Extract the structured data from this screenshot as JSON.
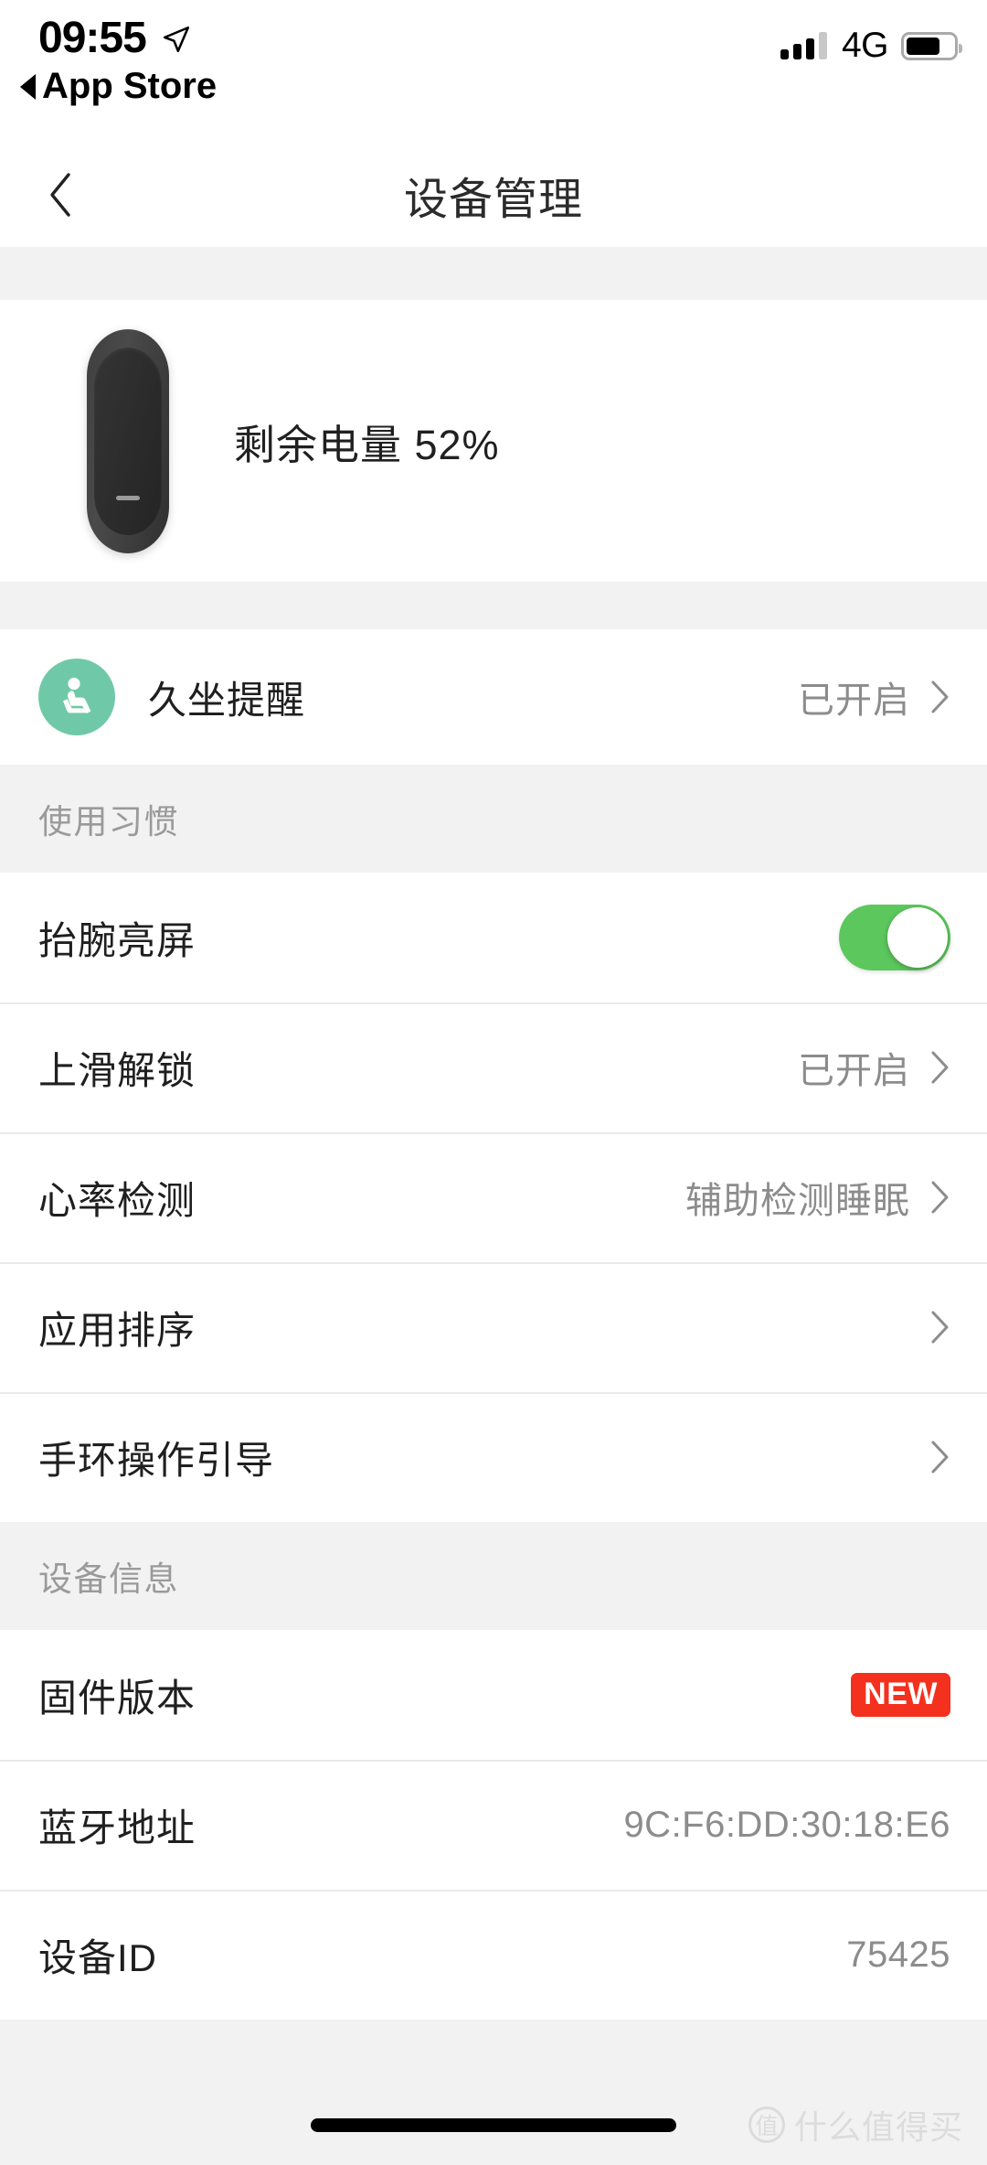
{
  "status_bar": {
    "time": "09:55",
    "location_icon": "location-arrow-icon",
    "back_app_label": "App Store",
    "network": "4G",
    "signal_bars_total": 4,
    "signal_bars_filled": 3,
    "battery_level_pct": 72
  },
  "nav": {
    "back_icon": "chevron-left-icon",
    "title": "设备管理"
  },
  "device": {
    "image_name": "mi-band-device",
    "battery_text": "剩余电量 52%"
  },
  "sedentary": {
    "icon": "seated-person-icon",
    "icon_color": "#6fc9a8",
    "label": "久坐提醒",
    "value": "已开启",
    "chevron": "chevron-right-icon"
  },
  "habits_section": {
    "header": "使用习惯",
    "rows": [
      {
        "label": "抬腕亮屏",
        "control": "toggle",
        "toggle_on": true,
        "value": "",
        "chevron": false
      },
      {
        "label": "上滑解锁",
        "control": "value",
        "value": "已开启",
        "chevron": true
      },
      {
        "label": "心率检测",
        "control": "value",
        "value": "辅助检测睡眠",
        "chevron": true
      },
      {
        "label": "应用排序",
        "control": "none",
        "value": "",
        "chevron": true
      },
      {
        "label": "手环操作引导",
        "control": "none",
        "value": "",
        "chevron": true
      }
    ]
  },
  "device_info_section": {
    "header": "设备信息",
    "rows": [
      {
        "label": "固件版本",
        "control": "badge",
        "badge": "NEW",
        "badge_color": "#f4301e",
        "value": "",
        "chevron": false
      },
      {
        "label": "蓝牙地址",
        "control": "value",
        "value": "9C:F6:DD:30:18:E6",
        "chevron": false
      },
      {
        "label": "设备ID",
        "control": "value",
        "value": "75425",
        "chevron": false
      }
    ]
  },
  "watermark": {
    "logo_char": "值",
    "text": "什么值得买"
  }
}
